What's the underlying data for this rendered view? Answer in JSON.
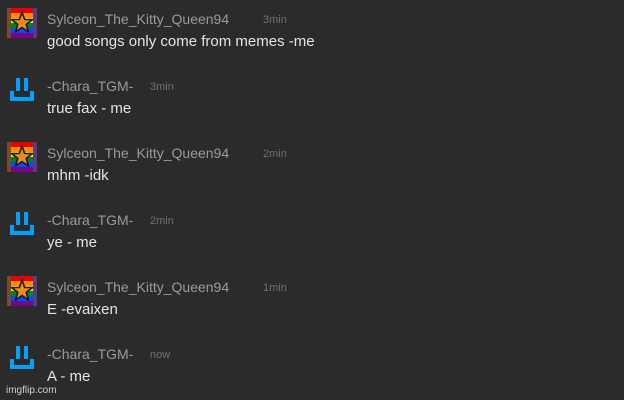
{
  "messages": [
    {
      "avatar": "rainbow-star-avatar",
      "username": "Sylceon_The_Kitty_Queen94",
      "time": "3min",
      "text": "good songs only come from memes -me"
    },
    {
      "avatar": "blue-face-avatar",
      "username": "-Chara_TGM-",
      "time": "3min",
      "text": "true fax - me"
    },
    {
      "avatar": "rainbow-star-avatar",
      "username": "Sylceon_The_Kitty_Queen94",
      "time": "2min",
      "text": "mhm -idk"
    },
    {
      "avatar": "blue-face-avatar",
      "username": "-Chara_TGM-",
      "time": "2min",
      "text": "ye - me"
    },
    {
      "avatar": "rainbow-star-avatar",
      "username": "Sylceon_The_Kitty_Queen94",
      "time": "1min",
      "text": "E -evaixen"
    },
    {
      "avatar": "blue-face-avatar",
      "username": "-Chara_TGM-",
      "time": "now",
      "text": "A - me"
    }
  ],
  "watermark": "imgflip.com",
  "colors": {
    "background": "#2b2b2b",
    "username": "#9a9a9a",
    "timestamp": "#6f6f6f",
    "message_text": "#e4e4e4",
    "face_avatar": "#00a2ff"
  }
}
